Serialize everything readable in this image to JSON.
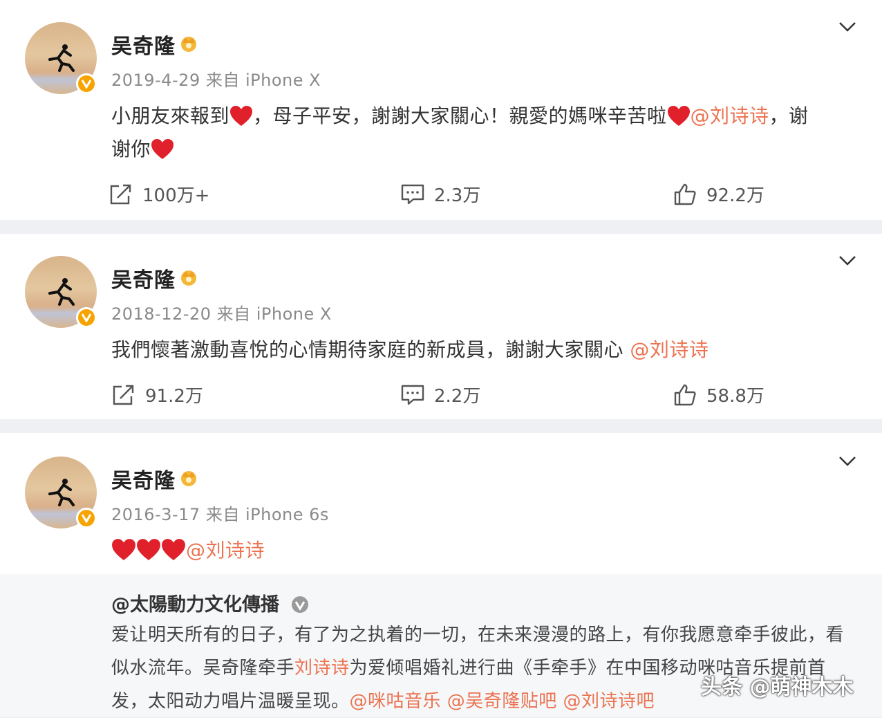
{
  "posts": [
    {
      "author": "吴奇隆",
      "meta": "2019-4-29 来自 iPhone X",
      "text_a": "小朋友來報到",
      "text_b": "，母子平安，謝謝大家關心！親愛的媽咪辛苦啦",
      "mention": "@刘诗诗",
      "text_c": "，谢",
      "text_d": "谢你",
      "reposts": "100万+",
      "comments": "2.3万",
      "likes": "92.2万"
    },
    {
      "author": "吴奇隆",
      "meta": "2018-12-20 来自 iPhone X",
      "text_a": "我們懷著激動喜悅的心情期待家庭的新成員，謝謝大家關心 ",
      "mention": "@刘诗诗",
      "reposts": "91.2万",
      "comments": "2.2万",
      "likes": "58.8万"
    },
    {
      "author": "吴奇隆",
      "meta": "2016-3-17 来自 iPhone 6s",
      "mention": "@刘诗诗",
      "repost": {
        "author": "@太陽動力文化傳播",
        "text_a": "爱让明天所有的日子，有了为之执着的一切，在未来漫漫的路上，有你我愿意牵手彼此，看似水流年。吴奇隆牵手",
        "mention_a": "刘诗诗",
        "text_b": "为爱倾唱婚礼进行曲《手牵手》在中国移动咪咕音乐提前首发，太阳动力唱片温暖呈现。",
        "mention_b": "@咪咕音乐 @吴奇隆贴吧 @刘诗诗吧"
      }
    }
  ],
  "watermark": "头条 @萌神木木",
  "colors": {
    "mention": "#eb7350",
    "heart": "#e0202a",
    "verified": "#f7a400"
  }
}
